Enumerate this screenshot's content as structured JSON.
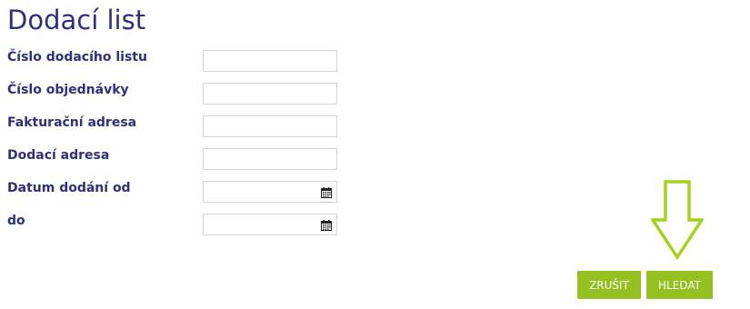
{
  "page": {
    "title": "Dodací list"
  },
  "form": {
    "fields": [
      {
        "label": "Číslo dodacího listu",
        "value": "",
        "type": "text"
      },
      {
        "label": "Číslo objednávky",
        "value": "",
        "type": "text"
      },
      {
        "label": "Fakturační adresa",
        "value": "",
        "type": "text"
      },
      {
        "label": "Dodací adresa",
        "value": "",
        "type": "text"
      },
      {
        "label": "Datum dodání od",
        "value": "",
        "type": "date",
        "icon": "calendar-icon"
      },
      {
        "label": "do",
        "value": "",
        "type": "date",
        "icon": "calendar-icon"
      }
    ]
  },
  "actions": {
    "cancel_label": "ZRUŠIT",
    "search_label": "HLEDAT"
  },
  "annotation": {
    "icon": "down-arrow-icon",
    "color": "#a6d21f"
  },
  "colors": {
    "title": "#2e3079",
    "label": "#2e3079",
    "button": "#94c11f",
    "input_border": "#cfd3da"
  }
}
